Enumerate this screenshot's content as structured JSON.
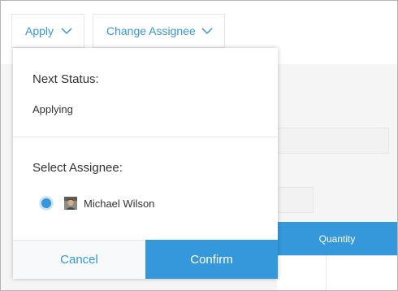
{
  "toolbar": {
    "apply_label": "Apply",
    "change_assignee_label": "Change Assignee"
  },
  "popup": {
    "next_status_label": "Next Status:",
    "next_status_value": "Applying",
    "select_assignee_label": "Select Assignee:",
    "assignees": [
      {
        "name": "Michael Wilson",
        "selected": true
      }
    ],
    "cancel_label": "Cancel",
    "confirm_label": "Confirm"
  },
  "background": {
    "table_header": "Quantity"
  },
  "colors": {
    "accent": "#3498db",
    "border": "#e3e7e8",
    "background": "#f5f5f5"
  },
  "icons": {
    "toolbar_dropdown": "chevron-down-icon",
    "assignee_avatar": "avatar-icon",
    "assignee_radio": "radio-selected"
  }
}
